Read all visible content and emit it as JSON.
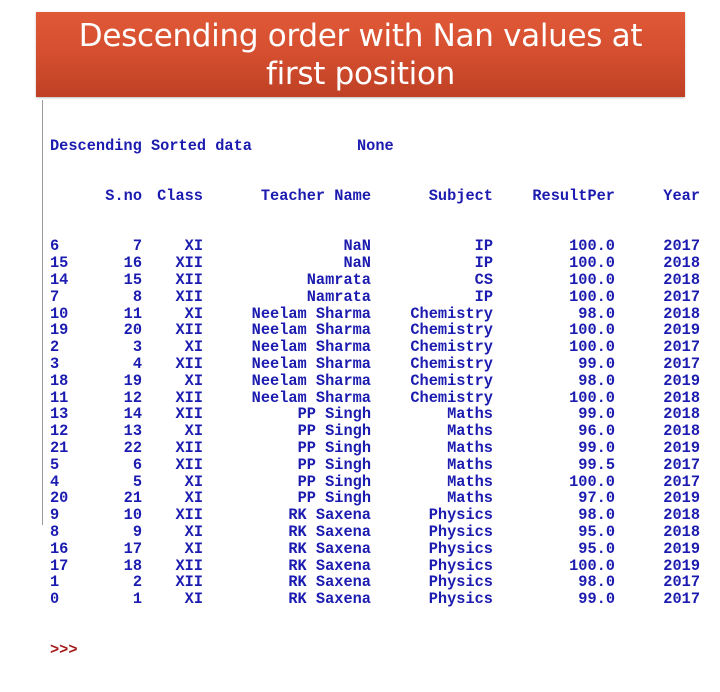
{
  "slide": {
    "title": "Descending order with Nan values at first position"
  },
  "console": {
    "caption": "Descending Sorted data",
    "caption_value": "None",
    "columns": [
      "S.no",
      "Class",
      "Teacher Name",
      "Subject",
      "ResultPer",
      "Year"
    ],
    "rows": [
      {
        "index": "6",
        "sno": "7",
        "class": "XI",
        "teacher": "NaN",
        "subject": "IP",
        "result": "100.0",
        "year": "2017"
      },
      {
        "index": "15",
        "sno": "16",
        "class": "XII",
        "teacher": "NaN",
        "subject": "IP",
        "result": "100.0",
        "year": "2018"
      },
      {
        "index": "14",
        "sno": "15",
        "class": "XII",
        "teacher": "Namrata",
        "subject": "CS",
        "result": "100.0",
        "year": "2018"
      },
      {
        "index": "7",
        "sno": "8",
        "class": "XII",
        "teacher": "Namrata",
        "subject": "IP",
        "result": "100.0",
        "year": "2017"
      },
      {
        "index": "10",
        "sno": "11",
        "class": "XI",
        "teacher": "Neelam Sharma",
        "subject": "Chemistry",
        "result": "98.0",
        "year": "2018"
      },
      {
        "index": "19",
        "sno": "20",
        "class": "XII",
        "teacher": "Neelam Sharma",
        "subject": "Chemistry",
        "result": "100.0",
        "year": "2019"
      },
      {
        "index": "2",
        "sno": "3",
        "class": "XI",
        "teacher": "Neelam Sharma",
        "subject": "Chemistry",
        "result": "100.0",
        "year": "2017"
      },
      {
        "index": "3",
        "sno": "4",
        "class": "XII",
        "teacher": "Neelam Sharma",
        "subject": "Chemistry",
        "result": "99.0",
        "year": "2017"
      },
      {
        "index": "18",
        "sno": "19",
        "class": "XI",
        "teacher": "Neelam Sharma",
        "subject": "Chemistry",
        "result": "98.0",
        "year": "2019"
      },
      {
        "index": "11",
        "sno": "12",
        "class": "XII",
        "teacher": "Neelam Sharma",
        "subject": "Chemistry",
        "result": "100.0",
        "year": "2018"
      },
      {
        "index": "13",
        "sno": "14",
        "class": "XII",
        "teacher": "PP Singh",
        "subject": "Maths",
        "result": "99.0",
        "year": "2018"
      },
      {
        "index": "12",
        "sno": "13",
        "class": "XI",
        "teacher": "PP Singh",
        "subject": "Maths",
        "result": "96.0",
        "year": "2018"
      },
      {
        "index": "21",
        "sno": "22",
        "class": "XII",
        "teacher": "PP Singh",
        "subject": "Maths",
        "result": "99.0",
        "year": "2019"
      },
      {
        "index": "5",
        "sno": "6",
        "class": "XII",
        "teacher": "PP Singh",
        "subject": "Maths",
        "result": "99.5",
        "year": "2017"
      },
      {
        "index": "4",
        "sno": "5",
        "class": "XI",
        "teacher": "PP Singh",
        "subject": "Maths",
        "result": "100.0",
        "year": "2017"
      },
      {
        "index": "20",
        "sno": "21",
        "class": "XI",
        "teacher": "PP Singh",
        "subject": "Maths",
        "result": "97.0",
        "year": "2019"
      },
      {
        "index": "9",
        "sno": "10",
        "class": "XII",
        "teacher": "RK Saxena",
        "subject": "Physics",
        "result": "98.0",
        "year": "2018"
      },
      {
        "index": "8",
        "sno": "9",
        "class": "XI",
        "teacher": "RK Saxena",
        "subject": "Physics",
        "result": "95.0",
        "year": "2018"
      },
      {
        "index": "16",
        "sno": "17",
        "class": "XI",
        "teacher": "RK Saxena",
        "subject": "Physics",
        "result": "95.0",
        "year": "2019"
      },
      {
        "index": "17",
        "sno": "18",
        "class": "XII",
        "teacher": "RK Saxena",
        "subject": "Physics",
        "result": "100.0",
        "year": "2019"
      },
      {
        "index": "1",
        "sno": "2",
        "class": "XII",
        "teacher": "RK Saxena",
        "subject": "Physics",
        "result": "98.0",
        "year": "2017"
      },
      {
        "index": "0",
        "sno": "1",
        "class": "XI",
        "teacher": "RK Saxena",
        "subject": "Physics",
        "result": "99.0",
        "year": "2017"
      }
    ],
    "prompt": ">>>"
  },
  "colors": {
    "banner": "#d44e2f",
    "console_text": "#1b1bb0",
    "prompt": "#a51c1c"
  }
}
